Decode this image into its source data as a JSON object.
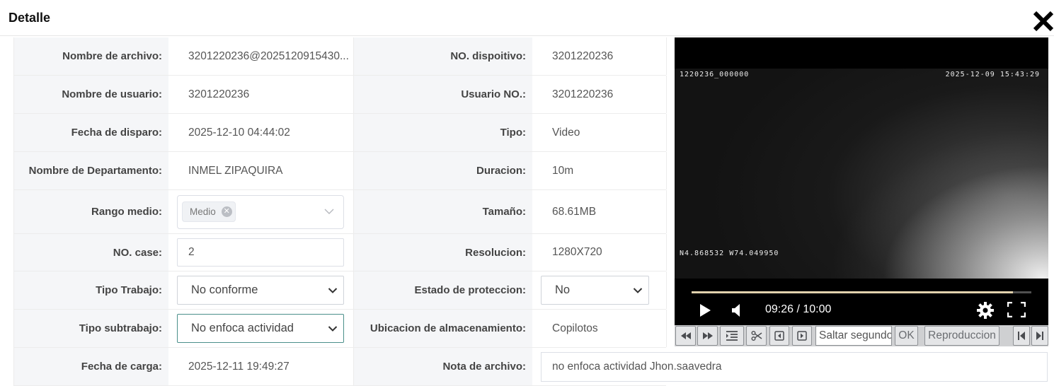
{
  "dialog": {
    "title": "Detalle"
  },
  "details": {
    "file_name": {
      "label": "Nombre de archivo:",
      "value": "3201220236@2025120915430..."
    },
    "device_no": {
      "label": "NO. dispoitivo:",
      "value": "3201220236"
    },
    "user_name": {
      "label": "Nombre de usuario:",
      "value": "3201220236"
    },
    "user_no": {
      "label": "Usuario NO.:",
      "value": "3201220236"
    },
    "trigger_date": {
      "label": "Fecha de disparo:",
      "value": "2025-12-10 04:44:02"
    },
    "type": {
      "label": "Tipo:",
      "value": "Video"
    },
    "department": {
      "label": "Nombre de Departamento:",
      "value": "INMEL ZIPAQUIRA"
    },
    "duration": {
      "label": "Duracion:",
      "value": "10m"
    },
    "range": {
      "label": "Rango medio:",
      "tag": "Medio"
    },
    "size": {
      "label": "Tamaño:",
      "value": "68.61MB"
    },
    "case_no": {
      "label": "NO. case:",
      "value": "2"
    },
    "resolution": {
      "label": "Resolucion:",
      "value": "1280X720"
    },
    "work_type": {
      "label": "Tipo Trabajo:",
      "value": "No conforme"
    },
    "protection": {
      "label": "Estado de proteccion:",
      "value": "No"
    },
    "work_subtype": {
      "label": "Tipo subtrabajo:",
      "value": "No enfoca actividad"
    },
    "storage": {
      "label": "Ubicacion de almacenamiento:",
      "value": "Copilotos"
    },
    "upload_date": {
      "label": "Fecha de carga:",
      "value": "2025-12-11 19:49:27"
    },
    "file_note": {
      "label": "Nota de archivo:",
      "value": "no enfoca actividad Jhon.saavedra"
    }
  },
  "player": {
    "osd_device": "1220236_000000",
    "osd_datetime": "2025-12-09 15:43:29",
    "osd_gps": "N4.868532 W74.049950",
    "time_display": "09:26 / 10:00",
    "progress_fraction": 0.945
  },
  "toolbar": {
    "seek_placeholder": "Saltar segundos",
    "ok_label": "OK",
    "playback_label": "Reproduccion"
  },
  "icons": [
    "close-icon",
    "chevron-down-icon",
    "play-icon",
    "volume-icon",
    "settings-icon",
    "fullscreen-icon",
    "rewind-icon",
    "fast-forward-icon",
    "list-icon",
    "scissors-icon",
    "frame-back-icon",
    "frame-forward-icon",
    "skip-start-icon",
    "skip-end-icon"
  ]
}
